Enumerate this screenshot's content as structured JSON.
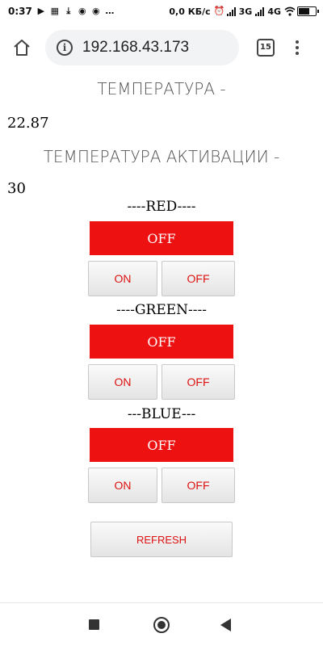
{
  "status_bar": {
    "time": "0:37",
    "network_speed": "0,0 КБ/с",
    "network_3g": "3G",
    "network_4g": "4G",
    "battery_level": 0.7
  },
  "browser": {
    "url": "192.168.43.173",
    "tab_count": "15"
  },
  "page": {
    "temperature_label": "ТЕМПЕРАТУРА -",
    "temperature_value": "22.87",
    "activation_label": "ТЕМПЕРАТУРА АКТИВАЦИИ -",
    "activation_value": "30",
    "channels": [
      {
        "header": "----RED----",
        "state": "OFF",
        "on_label": "ON",
        "off_label": "OFF"
      },
      {
        "header": "----GREEN----",
        "state": "OFF",
        "on_label": "ON",
        "off_label": "OFF"
      },
      {
        "header": "---BLUE---",
        "state": "OFF",
        "on_label": "ON",
        "off_label": "OFF"
      }
    ],
    "refresh_label": "REFRESH"
  },
  "colors": {
    "state_off_bg": "#ee1111",
    "button_text": "#dd1111"
  },
  "icons": [
    "youtube-icon",
    "qr-icon",
    "download-icon",
    "chrome-icon",
    "alarm-icon",
    "wifi-icon",
    "home-icon",
    "info-icon",
    "menu-icon"
  ]
}
